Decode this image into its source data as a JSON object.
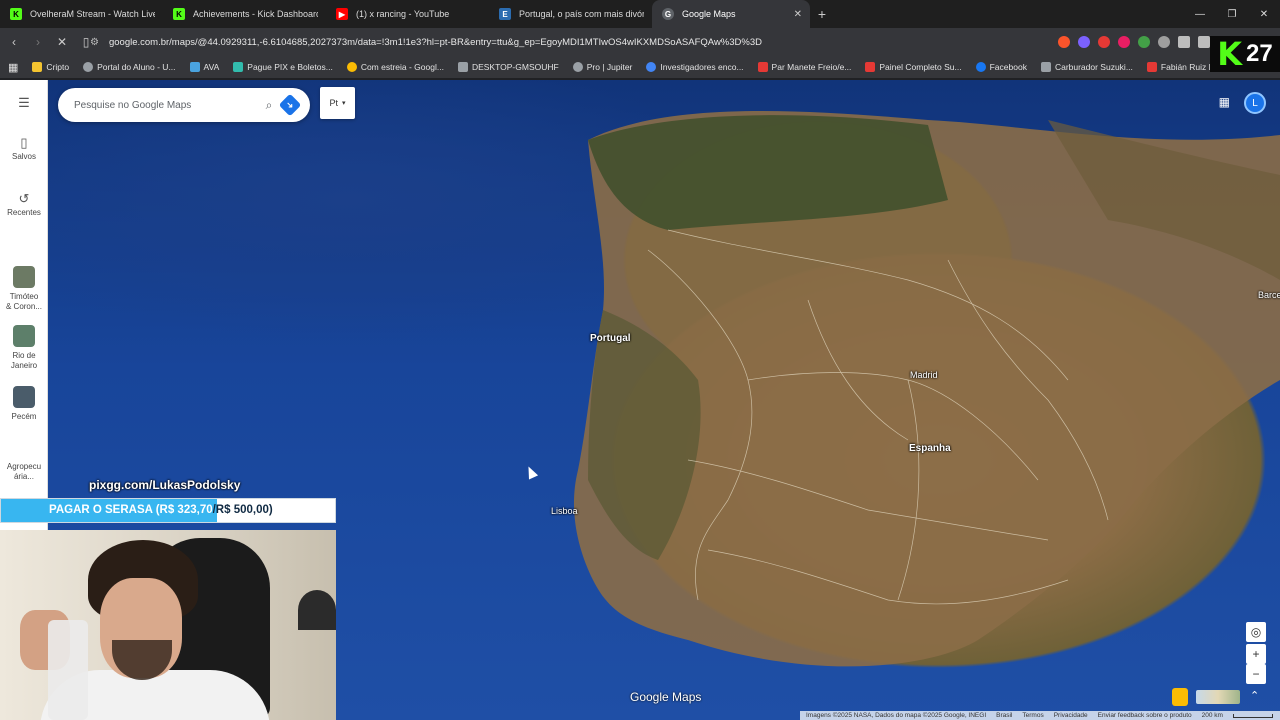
{
  "browser": {
    "tabs": [
      {
        "title": "OvelheraM Stream - Watch Live o",
        "favicon_color": "#53fc18",
        "favicon_icon": "kick-icon"
      },
      {
        "title": "Achievements - Kick Dashboard",
        "favicon_color": "#53fc18",
        "favicon_icon": "kick-icon"
      },
      {
        "title": "(1) x rancing - YouTube",
        "favicon_color": "#ff0000",
        "favicon_icon": "youtube-icon"
      },
      {
        "title": "Portugal, o país com mais divórcios",
        "favicon_color": "#2b6cb0",
        "favicon_icon": "news-icon"
      },
      {
        "title": "Google Maps",
        "favicon_color": "#9aa0a6",
        "favicon_icon": "google-maps-icon",
        "active": true
      }
    ],
    "url": "google.com.br/maps/@44.0929311,-6.6104685,2027373m/data=!3m1!1e3?hl=pt-BR&entry=ttu&g_ep=EgoyMDI1MTIwOS4wIKXMDSoASAFQAw%3D%3D",
    "bookmarks": [
      {
        "label": "Cripto",
        "color": "#f4c430"
      },
      {
        "label": "Portal do Aluno - U...",
        "color": "#9aa0a6"
      },
      {
        "label": "AVA",
        "color": "#4aa3df"
      },
      {
        "label": "Pague PIX e Boletos...",
        "color": "#32bcad"
      },
      {
        "label": "Com estreia - Googl...",
        "color": "#fbbc04"
      },
      {
        "label": "DESKTOP-GMSOUHF",
        "color": "#9aa0a6"
      },
      {
        "label": "Pro | Jupiter",
        "color": "#9aa0a6"
      },
      {
        "label": "Investigadores enco...",
        "color": "#4285f4"
      },
      {
        "label": "Par Manete Freio/e...",
        "color": "#e53935"
      },
      {
        "label": "Painel Completo Su...",
        "color": "#e53935"
      },
      {
        "label": "Facebook",
        "color": "#1877f2"
      },
      {
        "label": "Carburador Suzuki...",
        "color": "#9aa0a6"
      },
      {
        "label": "Fabián Ruiz FC Pro L...",
        "color": "#e53935"
      }
    ]
  },
  "kick_badge": {
    "letter": "K",
    "number": "27"
  },
  "maps": {
    "search_placeholder": "Pesquise no Google Maps",
    "layer_button": "Pt",
    "avatar_letter": "L",
    "rail": [
      {
        "label": "Salvos",
        "icon": "bookmark-icon"
      },
      {
        "label": "Recentes",
        "icon": "history-icon"
      },
      {
        "label": "Timóteo\n& Coron...",
        "icon": "place-thumb"
      },
      {
        "label": "Rio de\nJaneiro",
        "icon": "place-thumb"
      },
      {
        "label": "Pecém",
        "icon": "place-thumb"
      },
      {
        "label": "Agropecu\nária...",
        "icon": "place-thumb"
      }
    ],
    "labels": {
      "portugal": "Portugal",
      "madrid": "Madrid",
      "espanha": "Espanha",
      "lisboa": "Lisboa",
      "barcelona": "Barce"
    },
    "logo": "Google Maps",
    "attribution": [
      "Imagens ©2025 NASA, Dados do mapa ©2025 Google, INEGI",
      "Brasil",
      "Termos",
      "Privacidade",
      "Enviar feedback sobre o produto",
      "200 km"
    ]
  },
  "overlay": {
    "pix_text": "pixgg.com/LukasPodolsky",
    "goal_prefix": "PAGAR O SERASA (R$ 323,70",
    "goal_suffix": "/R$ 500,00)",
    "goal_progress": 0.6474,
    "goal_fill_color": "#38b6f0"
  }
}
